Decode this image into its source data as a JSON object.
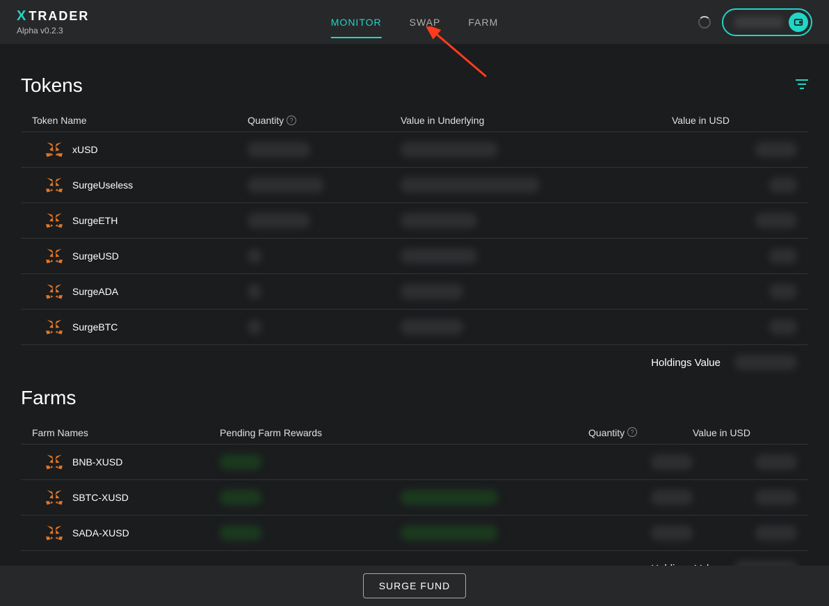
{
  "header": {
    "app_name": "TRADER",
    "version": "Alpha v0.2.3",
    "nav": {
      "monitor": "MONITOR",
      "swap": "SWAP",
      "farm": "FARM"
    }
  },
  "tokens": {
    "title": "Tokens",
    "headers": {
      "name": "Token Name",
      "quantity": "Quantity",
      "underlying": "Value in Underlying",
      "usd": "Value in USD"
    },
    "rows": [
      {
        "name": "xUSD"
      },
      {
        "name": "SurgeUseless"
      },
      {
        "name": "SurgeETH"
      },
      {
        "name": "SurgeUSD"
      },
      {
        "name": "SurgeADA"
      },
      {
        "name": "SurgeBTC"
      }
    ],
    "holdings_label": "Holdings Value"
  },
  "farms": {
    "title": "Farms",
    "headers": {
      "name": "Farm Names",
      "rewards": "Pending Farm Rewards",
      "quantity": "Quantity",
      "usd": "Value in USD"
    },
    "rows": [
      {
        "name": "BNB-XUSD"
      },
      {
        "name": "SBTC-XUSD"
      },
      {
        "name": "SADA-XUSD"
      }
    ],
    "holdings_label": "Holdings Value"
  },
  "bottom": {
    "surge_fund": "SURGE FUND"
  }
}
